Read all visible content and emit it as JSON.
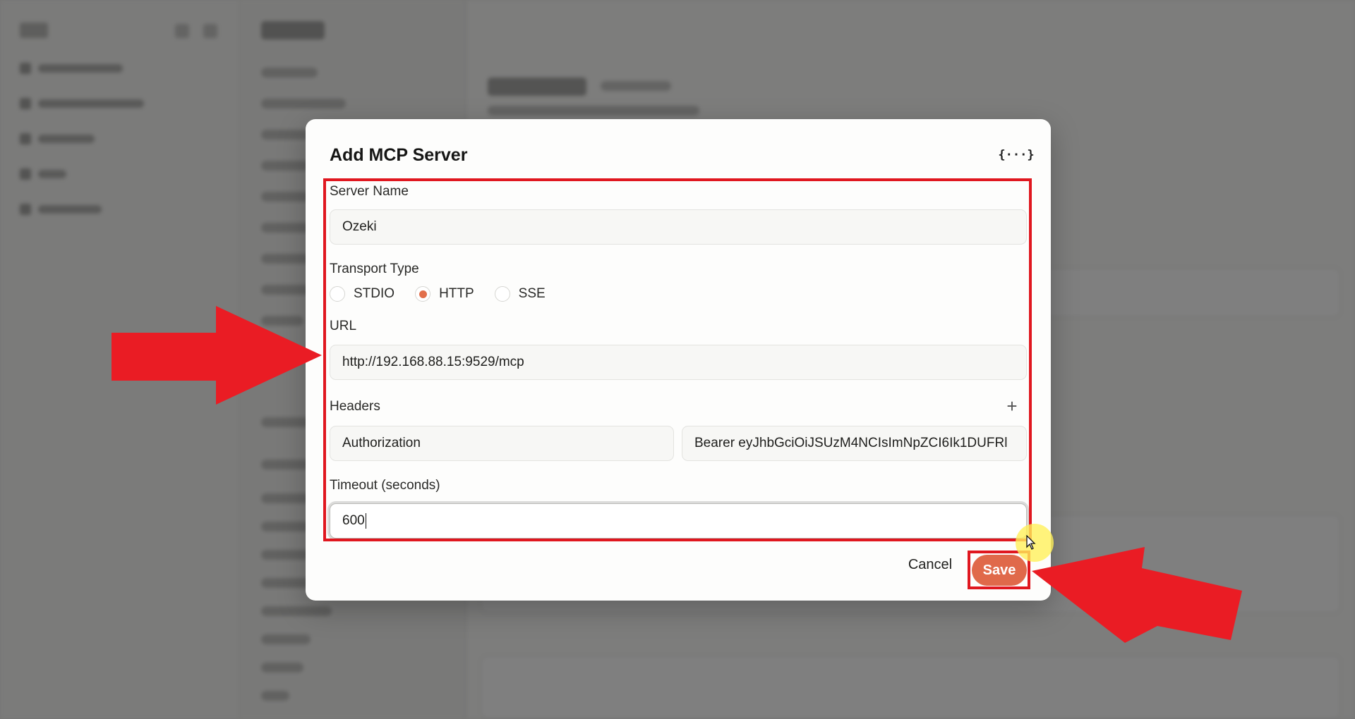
{
  "dialog": {
    "title": "Add MCP Server",
    "json_icon": "{···}",
    "server_name": {
      "label": "Server Name",
      "value": "Ozeki"
    },
    "transport": {
      "label": "Transport Type",
      "options": [
        "STDIO",
        "HTTP",
        "SSE"
      ],
      "selected": "HTTP"
    },
    "url": {
      "label": "URL",
      "value": "http://192.168.88.15:9529/mcp"
    },
    "headers": {
      "label": "Headers",
      "add_icon": "+",
      "key": "Authorization",
      "value": "Bearer eyJhbGciOiJSUzM4NCIsImNpZCI6Ik1DUFRl"
    },
    "timeout": {
      "label": "Timeout (seconds)",
      "value": "600"
    },
    "cancel_label": "Cancel",
    "save_label": "Save"
  },
  "colors": {
    "accent": "#e0694a",
    "annotation_red": "#e0171f",
    "cursor_highlight": "#fff05a"
  },
  "icons": {
    "json": "code-braces-icon",
    "add": "plus-icon",
    "annotation": "red-arrow-icon"
  }
}
